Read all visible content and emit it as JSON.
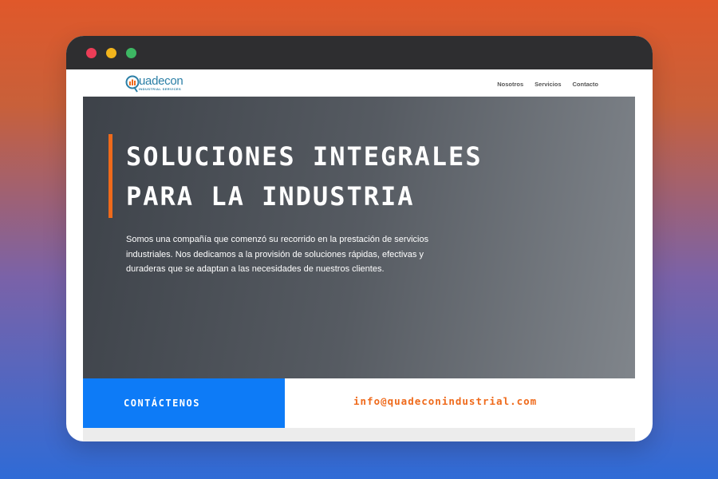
{
  "window": {
    "controls": [
      "close",
      "minimize",
      "maximize"
    ]
  },
  "header": {
    "logo": {
      "name": "uadecon",
      "tagline": "INDUSTRIAL SERVICES",
      "icon": "q-chart-logo-icon"
    },
    "nav": [
      {
        "label": "Nosotros"
      },
      {
        "label": "Servicios"
      },
      {
        "label": "Contacto"
      }
    ]
  },
  "hero": {
    "title_line1": "Soluciones integrales",
    "title_line2": "para la industria",
    "description": "Somos una compañía que comenzó su recorrido en la prestación de servicios industriales. Nos dedicamos a la provisión de soluciones rápidas, efectivas y duraderas que se adaptan a las necesidades de nuestros clientes."
  },
  "contact": {
    "cta_label": "Contáctenos",
    "email": "info@quadeconindustrial.com"
  },
  "colors": {
    "accent_orange": "#ef6a1b",
    "cta_blue": "#0d7bf7",
    "logo_teal": "#2b7fa6",
    "titlebar": "#2e2e30"
  }
}
